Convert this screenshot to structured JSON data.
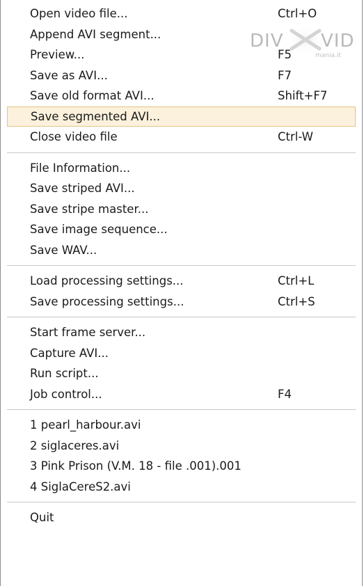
{
  "menu": {
    "group1": [
      {
        "label": "Open video file...",
        "shortcut": "Ctrl+O"
      },
      {
        "label": "Append AVI segment...",
        "shortcut": ""
      },
      {
        "label": "Preview...",
        "shortcut": "F5"
      },
      {
        "label": "Save as AVI...",
        "shortcut": "F7"
      },
      {
        "label": "Save old format AVI...",
        "shortcut": "Shift+F7"
      },
      {
        "label": "Save segmented AVI...",
        "shortcut": ""
      },
      {
        "label": "Close video file",
        "shortcut": "Ctrl-W"
      }
    ],
    "group2": [
      {
        "label": "File Information..."
      },
      {
        "label": "Save striped AVI..."
      },
      {
        "label": "Save stripe master..."
      },
      {
        "label": "Save image sequence..."
      },
      {
        "label": "Save WAV..."
      }
    ],
    "group3": [
      {
        "label": "Load processing settings...",
        "shortcut": "Ctrl+L"
      },
      {
        "label": "Save processing settings...",
        "shortcut": "Ctrl+S"
      }
    ],
    "group4": [
      {
        "label": "Start frame server...",
        "shortcut": ""
      },
      {
        "label": "Capture AVI...",
        "shortcut": ""
      },
      {
        "label": "Run script...",
        "shortcut": ""
      },
      {
        "label": "Job control...",
        "shortcut": "F4"
      }
    ],
    "recent_files": [
      {
        "label": "1 pearl_harbour.avi"
      },
      {
        "label": "2 siglaceres.avi"
      },
      {
        "label": "3 Pink Prison (V.M. 18 - file .001).001"
      },
      {
        "label": "4 SiglaCereS2.avi"
      }
    ],
    "quit": {
      "label": "Quit"
    },
    "highlighted_item": "Save segmented AVI..."
  },
  "watermark": {
    "text_left": "DIV",
    "text_right": "VID",
    "subtext": "mania.it"
  },
  "colors": {
    "highlight_bg": "#fbf1dc",
    "highlight_border": "#e3c487",
    "separator": "#c8c8c8",
    "text": "#1a1a1a"
  }
}
